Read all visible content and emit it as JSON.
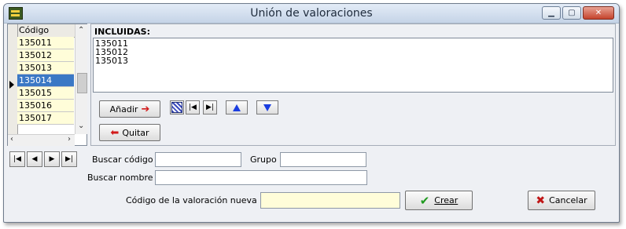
{
  "window": {
    "title": "Unión de valoraciones"
  },
  "grid": {
    "column_header": "Código",
    "rows": [
      "135011",
      "135012",
      "135013",
      "135014",
      "135015",
      "135016",
      "135017"
    ],
    "selected_index": 3
  },
  "included": {
    "label": "INCLUIDAS:",
    "items": [
      "135011",
      "135012",
      "135013"
    ]
  },
  "buttons": {
    "add": "Añadir",
    "remove": "Quitar",
    "create": "Crear",
    "cancel": "Cancelar"
  },
  "search": {
    "code_label": "Buscar código",
    "group_label": "Grupo",
    "name_label": "Buscar nombre",
    "code_value": "",
    "group_value": "",
    "name_value": ""
  },
  "new_valuation": {
    "label": "Código de la valoración nueva",
    "value": ""
  },
  "icons": {
    "title_bar": [
      "minimize-icon",
      "maximize-icon",
      "close-icon"
    ],
    "nav": [
      "first-icon",
      "prev-icon",
      "next-icon",
      "last-icon"
    ]
  },
  "colors": {
    "selection": "#3b78c5",
    "row_background": "#fffdd9",
    "create_check": "#1f9a1f",
    "cancel_x": "#c01616",
    "move_arrows": "#1b3ee0"
  }
}
